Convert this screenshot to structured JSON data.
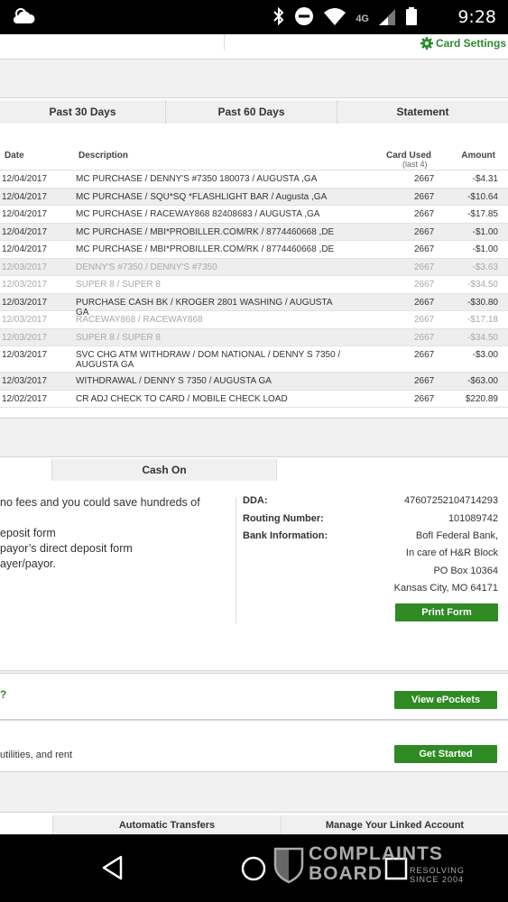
{
  "status_bar": {
    "time": "9:28",
    "network_label": "4G",
    "icons": [
      "weather-icon",
      "bluetooth-icon",
      "do-not-disturb-icon",
      "wifi-icon",
      "signal-icon",
      "battery-icon"
    ]
  },
  "header": {
    "card_settings_label": "Card Settings"
  },
  "tabs": [
    "Past 30 Days",
    "Past 60 Days",
    "Statement"
  ],
  "table": {
    "columns": {
      "date": "Date",
      "description": "Description",
      "card_used": "Card Used",
      "card_used_sub": "(last 4)",
      "amount": "Amount"
    },
    "rows": [
      {
        "date": "12/04/2017",
        "description": "MC PURCHASE / DENNY'S #7350 180073 / AUGUSTA ,GA",
        "card": "2667",
        "amount": "-$4.31"
      },
      {
        "date": "12/04/2017",
        "description": "MC PURCHASE / SQU*SQ *FLASHLIGHT BAR / Augusta ,GA",
        "card": "2667",
        "amount": "-$10.64"
      },
      {
        "date": "12/04/2017",
        "description": "MC PURCHASE / RACEWAY868 82408683 / AUGUSTA ,GA",
        "card": "2667",
        "amount": "-$17.85"
      },
      {
        "date": "12/04/2017",
        "description": "MC PURCHASE / MBI*PROBILLER.COM/RK / 8774460668 ,DE",
        "card": "2667",
        "amount": "-$1.00"
      },
      {
        "date": "12/04/2017",
        "description": "MC PURCHASE / MBI*PROBILLER.COM/RK / 8774460668 ,DE",
        "card": "2667",
        "amount": "-$1.00"
      },
      {
        "date": "12/03/2017",
        "description": "DENNY'S #7350 / DENNY'S #7350",
        "card": "2667",
        "amount": "-$3.63"
      },
      {
        "date": "12/03/2017",
        "description": "SUPER 8 / SUPER 8",
        "card": "2667",
        "amount": "-$34.50"
      },
      {
        "date": "12/03/2017",
        "description": "PURCHASE CASH BK / KROGER 2801 WASHING / AUGUSTA GA",
        "card": "2667",
        "amount": "-$30.80"
      },
      {
        "date": "12/03/2017",
        "description": "RACEWAY868 / RACEWAY868",
        "card": "2667",
        "amount": "-$17.18"
      },
      {
        "date": "12/03/2017",
        "description": "SUPER 8 / SUPER 8",
        "card": "2667",
        "amount": "-$34.50"
      },
      {
        "date": "12/03/2017",
        "description": "SVC CHG ATM WITHDRAW / DOM NATIONAL / DENNY S 7350 / AUGUSTA GA",
        "card": "2667",
        "amount": "-$3.00"
      },
      {
        "date": "12/03/2017",
        "description": "WITHDRAWAL / DENNY S 7350 / AUGUSTA GA",
        "card": "2667",
        "amount": "-$63.00"
      },
      {
        "date": "12/02/2017",
        "description": "CR ADJ CHECK TO CARD / MOBILE CHECK LOAD",
        "card": "2667",
        "amount": "$220.89"
      }
    ]
  },
  "direct_deposit": {
    "tab_label": "Cash On",
    "left_lines": [
      "no fees and you could save hundreds of",
      "",
      "eposit form",
      "payor’s direct deposit form",
      "ayer/payor."
    ],
    "dda_label": "DDA:",
    "dda_value": "47607252104714293",
    "routing_label": "Routing Number:",
    "routing_value": "101089742",
    "bank_label": "Bank Information:",
    "bank_lines": [
      "BofI Federal Bank,",
      "In care of H&R Block",
      "PO Box 10364",
      "Kansas City, MO 64171"
    ],
    "print_button": "Print Form"
  },
  "epockets": {
    "question": "?",
    "button": "View ePockets"
  },
  "get_started": {
    "text": "utilities, and rent",
    "button": "Get Started"
  },
  "bottom_tabs": [
    "Automatic Transfers",
    "Manage Your Linked Account"
  ],
  "watermark": {
    "line1": "COMPLAINTS",
    "line2": "BOARD",
    "line3": "RESOLVING",
    "line4": "SINCE 2004"
  }
}
